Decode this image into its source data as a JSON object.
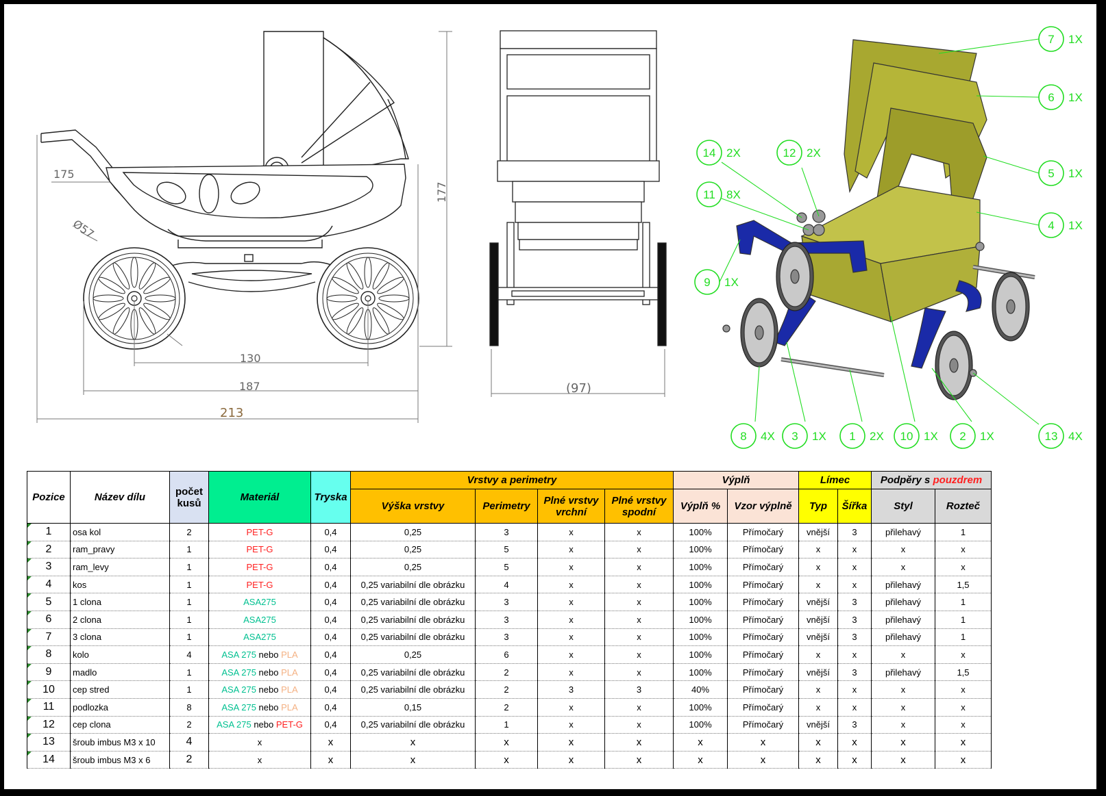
{
  "dimensions": {
    "side_view": [
      "175",
      "Ø57",
      "177",
      "130",
      "187",
      "213"
    ],
    "front_view": [
      "(97)"
    ]
  },
  "callouts": [
    {
      "n": "7",
      "q": "1X"
    },
    {
      "n": "6",
      "q": "1X"
    },
    {
      "n": "5",
      "q": "1X"
    },
    {
      "n": "4",
      "q": "1X"
    },
    {
      "n": "14",
      "q": "2X"
    },
    {
      "n": "12",
      "q": "2X"
    },
    {
      "n": "11",
      "q": "8X"
    },
    {
      "n": "9",
      "q": "1X"
    },
    {
      "n": "8",
      "q": "4X"
    },
    {
      "n": "3",
      "q": "1X"
    },
    {
      "n": "1",
      "q": "2X"
    },
    {
      "n": "10",
      "q": "1X"
    },
    {
      "n": "2",
      "q": "1X"
    },
    {
      "n": "13",
      "q": "4X"
    }
  ],
  "colors": {
    "callout": "#22dd22",
    "part_yellow": "#a8a830",
    "part_blue": "#1a2aa8",
    "material_red": "#ff2020",
    "material_green": "#00c090",
    "material_tan": "#f4b183"
  },
  "table": {
    "headers": {
      "pozice": "Pozice",
      "nazev": "Název dílu",
      "pocet_line1": "počet",
      "pocet_line2": "kusů",
      "material": "Materiál",
      "tryska": "Tryska",
      "vrstvy_group": "Vrstvy a perimetry",
      "vyska": "Výška vrstvy",
      "perimetry": "Perimetry",
      "plne_vrchni_1": "Plné vrstvy",
      "plne_vrchni_2": "vrchní",
      "plne_spodni_1": "Plné vrstvy",
      "plne_spodni_2": "spodní",
      "vypln_group": "Výplň",
      "vypln_pct": "Výplň %",
      "vzor": "Vzor výplně",
      "limec_group": "Límec",
      "typ": "Typ",
      "sirka": "Šířka",
      "podpery_group": "Podpěry s",
      "podpery_group_red": "pouzdrem",
      "styl": "Styl",
      "roztec": "Rozteč"
    },
    "rows": [
      {
        "pos": "1",
        "name": "osa kol",
        "ks": "2",
        "mat": [
          {
            "t": "PET-G",
            "c": "red"
          }
        ],
        "tryska": "0,4",
        "vyska": "0,25",
        "perim": "3",
        "vrchni": "x",
        "spodni": "x",
        "vypln": "100%",
        "vzor": "Přímočarý",
        "typ": "vnější",
        "sirka": "3",
        "styl": "přilehavý",
        "roztec": "1"
      },
      {
        "pos": "2",
        "name": "ram_pravy",
        "ks": "1",
        "mat": [
          {
            "t": "PET-G",
            "c": "red"
          }
        ],
        "tryska": "0,4",
        "vyska": "0,25",
        "perim": "5",
        "vrchni": "x",
        "spodni": "x",
        "vypln": "100%",
        "vzor": "Přímočarý",
        "typ": "x",
        "sirka": "x",
        "styl": "x",
        "roztec": "x"
      },
      {
        "pos": "3",
        "name": "ram_levy",
        "ks": "1",
        "mat": [
          {
            "t": "PET-G",
            "c": "red"
          }
        ],
        "tryska": "0,4",
        "vyska": "0,25",
        "perim": "5",
        "vrchni": "x",
        "spodni": "x",
        "vypln": "100%",
        "vzor": "Přímočarý",
        "typ": "x",
        "sirka": "x",
        "styl": "x",
        "roztec": "x"
      },
      {
        "pos": "4",
        "name": "kos",
        "ks": "1",
        "mat": [
          {
            "t": "PET-G",
            "c": "red"
          }
        ],
        "tryska": "0,4",
        "vyska": "0,25 variabilní dle obrázku",
        "perim": "4",
        "vrchni": "x",
        "spodni": "x",
        "vypln": "100%",
        "vzor": "Přímočarý",
        "typ": "x",
        "sirka": "x",
        "styl": "přilehavý",
        "roztec": "1,5"
      },
      {
        "pos": "5",
        "name": "1 clona",
        "ks": "1",
        "mat": [
          {
            "t": "ASA275",
            "c": "green"
          }
        ],
        "tryska": "0,4",
        "vyska": "0,25 variabilní dle obrázku",
        "perim": "3",
        "vrchni": "x",
        "spodni": "x",
        "vypln": "100%",
        "vzor": "Přímočarý",
        "typ": "vnější",
        "sirka": "3",
        "styl": "přilehavý",
        "roztec": "1"
      },
      {
        "pos": "6",
        "name": "2 clona",
        "ks": "1",
        "mat": [
          {
            "t": "ASA275",
            "c": "green"
          }
        ],
        "tryska": "0,4",
        "vyska": "0,25 variabilní dle obrázku",
        "perim": "3",
        "vrchni": "x",
        "spodni": "x",
        "vypln": "100%",
        "vzor": "Přímočarý",
        "typ": "vnější",
        "sirka": "3",
        "styl": "přilehavý",
        "roztec": "1"
      },
      {
        "pos": "7",
        "name": "3 clona",
        "ks": "1",
        "mat": [
          {
            "t": "ASA275",
            "c": "green"
          }
        ],
        "tryska": "0,4",
        "vyska": "0,25 variabilní dle obrázku",
        "perim": "3",
        "vrchni": "x",
        "spodni": "x",
        "vypln": "100%",
        "vzor": "Přímočarý",
        "typ": "vnější",
        "sirka": "3",
        "styl": "přilehavý",
        "roztec": "1"
      },
      {
        "pos": "8",
        "name": "kolo",
        "ks": "4",
        "mat": [
          {
            "t": "ASA 275",
            "c": "green"
          },
          {
            "t": " nebo ",
            "c": "black"
          },
          {
            "t": "PLA",
            "c": "tan"
          }
        ],
        "tryska": "0,4",
        "vyska": "0,25",
        "perim": "6",
        "vrchni": "x",
        "spodni": "x",
        "vypln": "100%",
        "vzor": "Přímočarý",
        "typ": "x",
        "sirka": "x",
        "styl": "x",
        "roztec": "x"
      },
      {
        "pos": "9",
        "name": "madlo",
        "ks": "1",
        "mat": [
          {
            "t": "ASA 275",
            "c": "green"
          },
          {
            "t": " nebo ",
            "c": "black"
          },
          {
            "t": "PLA",
            "c": "tan"
          }
        ],
        "tryska": "0,4",
        "vyska": "0,25 variabilní dle obrázku",
        "perim": "2",
        "vrchni": "x",
        "spodni": "x",
        "vypln": "100%",
        "vzor": "Přímočarý",
        "typ": "vnější",
        "sirka": "3",
        "styl": "přilehavý",
        "roztec": "1,5"
      },
      {
        "pos": "10",
        "name": "cep stred",
        "ks": "1",
        "mat": [
          {
            "t": "ASA 275",
            "c": "green"
          },
          {
            "t": " nebo ",
            "c": "black"
          },
          {
            "t": "PLA",
            "c": "tan"
          }
        ],
        "tryska": "0,4",
        "vyska": "0,25 variabilní dle obrázku",
        "perim": "2",
        "vrchni": "3",
        "spodni": "3",
        "vypln": "40%",
        "vzor": "Přímočarý",
        "typ": "x",
        "sirka": "x",
        "styl": "x",
        "roztec": "x"
      },
      {
        "pos": "11",
        "name": "podlozka",
        "ks": "8",
        "mat": [
          {
            "t": "ASA 275",
            "c": "green"
          },
          {
            "t": " nebo ",
            "c": "black"
          },
          {
            "t": "PLA",
            "c": "tan"
          }
        ],
        "tryska": "0,4",
        "vyska": "0,15",
        "perim": "2",
        "vrchni": "x",
        "spodni": "x",
        "vypln": "100%",
        "vzor": "Přímočarý",
        "typ": "x",
        "sirka": "x",
        "styl": "x",
        "roztec": "x"
      },
      {
        "pos": "12",
        "name": "cep clona",
        "ks": "2",
        "mat": [
          {
            "t": "ASA 275",
            "c": "green"
          },
          {
            "t": " nebo ",
            "c": "black"
          },
          {
            "t": "PET-G",
            "c": "red"
          }
        ],
        "tryska": "0,4",
        "vyska": "0,25 variabilní dle obrázku",
        "perim": "1",
        "vrchni": "x",
        "spodni": "x",
        "vypln": "100%",
        "vzor": "Přímočarý",
        "typ": "vnější",
        "sirka": "3",
        "styl": "x",
        "roztec": "x"
      },
      {
        "pos": "13",
        "name": "šroub imbus M3 x 10",
        "ks": "4",
        "mat": [
          {
            "t": "x",
            "c": "black"
          }
        ],
        "tryska": "x",
        "vyska": "x",
        "perim": "x",
        "vrchni": "x",
        "spodni": "x",
        "vypln": "x",
        "vzor": "x",
        "typ": "x",
        "sirka": "x",
        "styl": "x",
        "roztec": "x"
      },
      {
        "pos": "14",
        "name": "šroub imbus M3 x 6",
        "ks": "2",
        "mat": [
          {
            "t": "x",
            "c": "black"
          }
        ],
        "tryska": "x",
        "vyska": "x",
        "perim": "x",
        "vrchni": "x",
        "spodni": "x",
        "vypln": "x",
        "vzor": "x",
        "typ": "x",
        "sirka": "x",
        "styl": "x",
        "roztec": "x"
      }
    ]
  }
}
